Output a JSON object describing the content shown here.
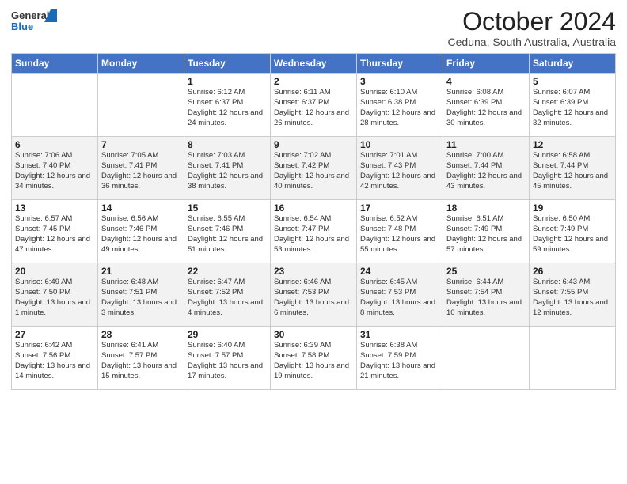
{
  "header": {
    "logo_general": "General",
    "logo_blue": "Blue",
    "month_title": "October 2024",
    "location": "Ceduna, South Australia, Australia"
  },
  "weekdays": [
    "Sunday",
    "Monday",
    "Tuesday",
    "Wednesday",
    "Thursday",
    "Friday",
    "Saturday"
  ],
  "weeks": [
    [
      {
        "day": "",
        "info": ""
      },
      {
        "day": "",
        "info": ""
      },
      {
        "day": "1",
        "info": "Sunrise: 6:12 AM\nSunset: 6:37 PM\nDaylight: 12 hours\nand 24 minutes."
      },
      {
        "day": "2",
        "info": "Sunrise: 6:11 AM\nSunset: 6:37 PM\nDaylight: 12 hours\nand 26 minutes."
      },
      {
        "day": "3",
        "info": "Sunrise: 6:10 AM\nSunset: 6:38 PM\nDaylight: 12 hours\nand 28 minutes."
      },
      {
        "day": "4",
        "info": "Sunrise: 6:08 AM\nSunset: 6:39 PM\nDaylight: 12 hours\nand 30 minutes."
      },
      {
        "day": "5",
        "info": "Sunrise: 6:07 AM\nSunset: 6:39 PM\nDaylight: 12 hours\nand 32 minutes."
      }
    ],
    [
      {
        "day": "6",
        "info": "Sunrise: 7:06 AM\nSunset: 7:40 PM\nDaylight: 12 hours\nand 34 minutes."
      },
      {
        "day": "7",
        "info": "Sunrise: 7:05 AM\nSunset: 7:41 PM\nDaylight: 12 hours\nand 36 minutes."
      },
      {
        "day": "8",
        "info": "Sunrise: 7:03 AM\nSunset: 7:41 PM\nDaylight: 12 hours\nand 38 minutes."
      },
      {
        "day": "9",
        "info": "Sunrise: 7:02 AM\nSunset: 7:42 PM\nDaylight: 12 hours\nand 40 minutes."
      },
      {
        "day": "10",
        "info": "Sunrise: 7:01 AM\nSunset: 7:43 PM\nDaylight: 12 hours\nand 42 minutes."
      },
      {
        "day": "11",
        "info": "Sunrise: 7:00 AM\nSunset: 7:44 PM\nDaylight: 12 hours\nand 43 minutes."
      },
      {
        "day": "12",
        "info": "Sunrise: 6:58 AM\nSunset: 7:44 PM\nDaylight: 12 hours\nand 45 minutes."
      }
    ],
    [
      {
        "day": "13",
        "info": "Sunrise: 6:57 AM\nSunset: 7:45 PM\nDaylight: 12 hours\nand 47 minutes."
      },
      {
        "day": "14",
        "info": "Sunrise: 6:56 AM\nSunset: 7:46 PM\nDaylight: 12 hours\nand 49 minutes."
      },
      {
        "day": "15",
        "info": "Sunrise: 6:55 AM\nSunset: 7:46 PM\nDaylight: 12 hours\nand 51 minutes."
      },
      {
        "day": "16",
        "info": "Sunrise: 6:54 AM\nSunset: 7:47 PM\nDaylight: 12 hours\nand 53 minutes."
      },
      {
        "day": "17",
        "info": "Sunrise: 6:52 AM\nSunset: 7:48 PM\nDaylight: 12 hours\nand 55 minutes."
      },
      {
        "day": "18",
        "info": "Sunrise: 6:51 AM\nSunset: 7:49 PM\nDaylight: 12 hours\nand 57 minutes."
      },
      {
        "day": "19",
        "info": "Sunrise: 6:50 AM\nSunset: 7:49 PM\nDaylight: 12 hours\nand 59 minutes."
      }
    ],
    [
      {
        "day": "20",
        "info": "Sunrise: 6:49 AM\nSunset: 7:50 PM\nDaylight: 13 hours\nand 1 minute."
      },
      {
        "day": "21",
        "info": "Sunrise: 6:48 AM\nSunset: 7:51 PM\nDaylight: 13 hours\nand 3 minutes."
      },
      {
        "day": "22",
        "info": "Sunrise: 6:47 AM\nSunset: 7:52 PM\nDaylight: 13 hours\nand 4 minutes."
      },
      {
        "day": "23",
        "info": "Sunrise: 6:46 AM\nSunset: 7:53 PM\nDaylight: 13 hours\nand 6 minutes."
      },
      {
        "day": "24",
        "info": "Sunrise: 6:45 AM\nSunset: 7:53 PM\nDaylight: 13 hours\nand 8 minutes."
      },
      {
        "day": "25",
        "info": "Sunrise: 6:44 AM\nSunset: 7:54 PM\nDaylight: 13 hours\nand 10 minutes."
      },
      {
        "day": "26",
        "info": "Sunrise: 6:43 AM\nSunset: 7:55 PM\nDaylight: 13 hours\nand 12 minutes."
      }
    ],
    [
      {
        "day": "27",
        "info": "Sunrise: 6:42 AM\nSunset: 7:56 PM\nDaylight: 13 hours\nand 14 minutes."
      },
      {
        "day": "28",
        "info": "Sunrise: 6:41 AM\nSunset: 7:57 PM\nDaylight: 13 hours\nand 15 minutes."
      },
      {
        "day": "29",
        "info": "Sunrise: 6:40 AM\nSunset: 7:57 PM\nDaylight: 13 hours\nand 17 minutes."
      },
      {
        "day": "30",
        "info": "Sunrise: 6:39 AM\nSunset: 7:58 PM\nDaylight: 13 hours\nand 19 minutes."
      },
      {
        "day": "31",
        "info": "Sunrise: 6:38 AM\nSunset: 7:59 PM\nDaylight: 13 hours\nand 21 minutes."
      },
      {
        "day": "",
        "info": ""
      },
      {
        "day": "",
        "info": ""
      }
    ]
  ]
}
